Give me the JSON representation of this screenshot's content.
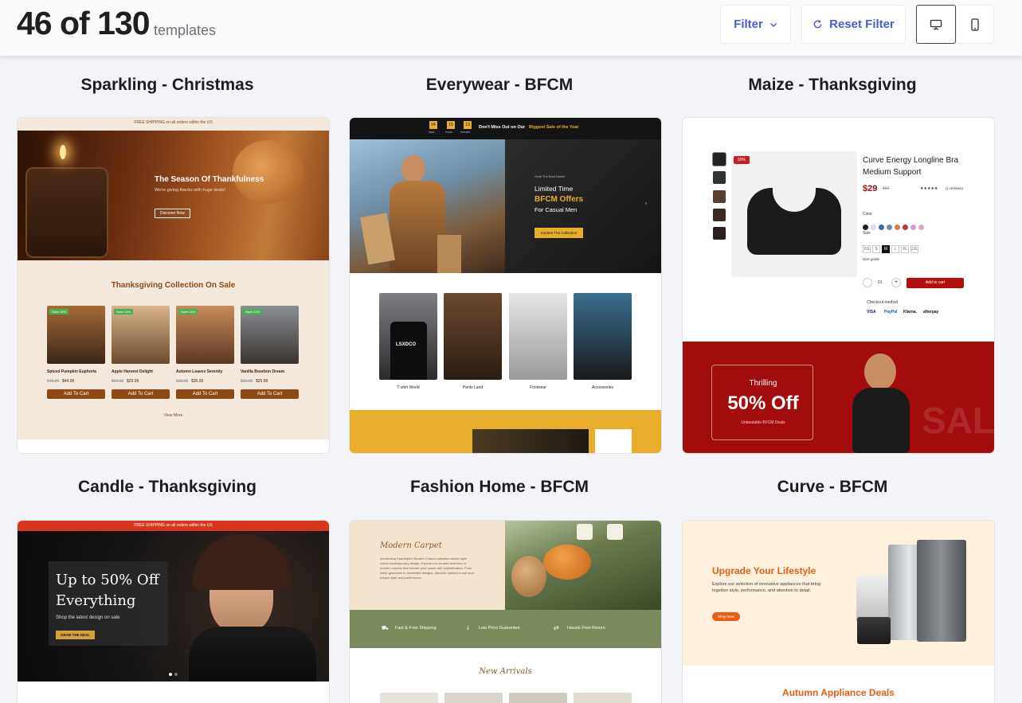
{
  "header": {
    "shown": "46 of 130",
    "suffix": "templates",
    "filter_label": "Filter",
    "reset_label": "Reset Filter",
    "view_desktop": "desktop-icon",
    "view_mobile": "mobile-icon"
  },
  "colors": {
    "accent": "#4a5bd4",
    "christmas_bg": "#f4e9dc",
    "product_brown": "#8c4a17",
    "bfcm_yellow": "#e8ae2b",
    "maize_red": "#a30c0c",
    "candle_red": "#d6371c",
    "curve_orange": "#e65f13",
    "fashion_green": "#7b8a5b"
  },
  "cards": [
    {
      "title": "Sparkling - Christmas",
      "preview": {
        "top_bar": "FREE SHIPPING on all orders within the US",
        "hero_title": "The Season Of Thankfulness",
        "hero_sub": "We're giving thanks with huge deals!",
        "hero_cta": "Discover Now",
        "section_title": "Thanksgiving Collection On Sale",
        "products": [
          {
            "name": "Spiced Pumpkin Euphoria",
            "old": "$49.99",
            "price": "$44.95",
            "badge": "Save 10%"
          },
          {
            "name": "Apple Harvest Delight",
            "old": "$34.99",
            "price": "$29.99",
            "badge": "Save 14%"
          },
          {
            "name": "Autumn Leaves Serenity",
            "old": "$39.99",
            "price": "$30.99",
            "badge": "Save 22%"
          },
          {
            "name": "Vanilla Bourbon Dream",
            "old": "$32.99",
            "price": "$25.99",
            "badge": "Save 21%"
          }
        ],
        "add_to_cart": "Add To Cart",
        "view_more": "View More"
      }
    },
    {
      "title": "Everywear - BFCM",
      "preview": {
        "countdown": [
          "04",
          "16",
          "13"
        ],
        "countdown_units": [
          "days",
          "hours",
          "minutes"
        ],
        "banner": "Don't Miss Out on Our",
        "banner_highlight": "Biggest Sale of the Year",
        "kicker": "Grab The Best Deals!",
        "h1": "Limited Time",
        "h2": "BFCM Offers",
        "h3": "For Casual Men",
        "cta": "Explore The Collection",
        "categories": [
          "T-shirt World",
          "Pants Land",
          "Footwear",
          "Accessories"
        ],
        "shirt_print": "LSXDCO"
      }
    },
    {
      "title": "Maize - Thanksgiving",
      "preview": {
        "badge": "50%",
        "product_name": "Curve Energy Longline Bra Medium Support",
        "price": "$29",
        "old_price": "$59",
        "reviews": "(1 reviews)",
        "stars": "★★★★★",
        "color_label": "Color",
        "size_label": "Size",
        "sizes": [
          "XS",
          "S",
          "M",
          "L",
          "XL",
          "2XL"
        ],
        "size_guide": "Size guide",
        "qty": "01",
        "add": "Add to cart",
        "checkout": "Checkout method",
        "payments": [
          "VISA",
          "PayPal",
          "Klarna.",
          "afterpay"
        ],
        "promo_kicker": "Thrilling",
        "promo_big": "50% Off",
        "promo_sub": "Unbeatable BFCM Deals",
        "watermark": "SALE"
      }
    },
    {
      "title": "Candle - Thanksgiving",
      "preview": {
        "top_bar": "FREE SHIPPING on all orders within the US",
        "h1": "Up to 50% Off",
        "h2": "Everything",
        "sub": "Shop the latest design on sale",
        "cta": "GRAB THE DEAL"
      }
    },
    {
      "title": "Fashion Home - BFCM",
      "preview": {
        "script_title": "Modern Carpet",
        "body": "Introducing Carpetiple's Modern Carpet collection where style meets contemporary design. Explore our curated selection of modern carpets that elevate your space with sophistication. From sleek geometric to minimalist designs, discover options to suit your unique style and preferences.",
        "features": [
          "Fast & Free Shipping",
          "Low Price Guarantee",
          "Hassle Free Return"
        ],
        "new_arrivals": "New Arrivals"
      }
    },
    {
      "title": "Curve - BFCM",
      "preview": {
        "h1": "Upgrade Your Lifestyle",
        "body": "Explore our selection of innovative appliances that bring together style, performance, and attention to detail.",
        "cta": "Shop Now",
        "section": "Autumn Appliance Deals"
      }
    }
  ]
}
